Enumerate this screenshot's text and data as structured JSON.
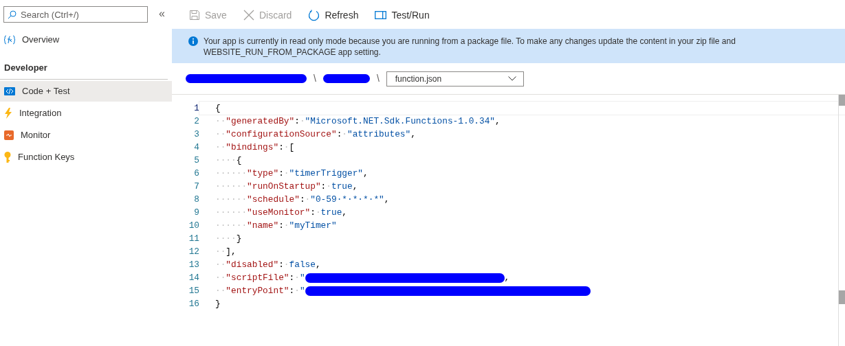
{
  "sidebar": {
    "search": {
      "placeholder": "Search (Ctrl+/)"
    },
    "collapse": "«",
    "items": [
      {
        "label": "Overview",
        "selected": false
      },
      {
        "label": "Developer",
        "kind": "heading"
      },
      {
        "label": "Code + Test",
        "selected": true
      },
      {
        "label": "Integration",
        "selected": false
      },
      {
        "label": "Monitor",
        "selected": false
      },
      {
        "label": "Function Keys",
        "selected": false
      }
    ]
  },
  "toolbar": [
    {
      "label": "Save",
      "disabled": true
    },
    {
      "label": "Discard",
      "disabled": true
    },
    {
      "label": "Refresh",
      "disabled": false
    },
    {
      "label": "Test/Run",
      "disabled": false
    }
  ],
  "banner": {
    "text": "Your app is currently in read only mode because you are running from a package file. To make any changes update the content in your zip file and WEBSITE_RUN_FROM_PACKAGE app setting."
  },
  "breadcrumb": [
    {
      "kind": "redacted"
    },
    {
      "kind": "separator",
      "text": "\\"
    },
    {
      "kind": "redacted"
    },
    {
      "kind": "separator",
      "text": "\\"
    },
    {
      "kind": "dropdown",
      "text": "function.json"
    }
  ],
  "editor": {
    "lines": [
      {
        "number": "1",
        "tokens": [
          {
            "kind": "punct",
            "text": "{"
          }
        ]
      },
      {
        "number": "2",
        "tokens": [
          {
            "kind": "space",
            "text": "··"
          },
          {
            "kind": "key",
            "text": "\"generatedBy\""
          },
          {
            "kind": "punct",
            "text": ":"
          },
          {
            "kind": "space",
            "text": "·"
          },
          {
            "kind": "string",
            "text": "\"Microsoft.NET.Sdk.Functions-1.0.34\""
          },
          {
            "kind": "punct",
            "text": ","
          }
        ]
      },
      {
        "number": "3",
        "tokens": [
          {
            "kind": "space",
            "text": "··"
          },
          {
            "kind": "key",
            "text": "\"configurationSource\""
          },
          {
            "kind": "punct",
            "text": ":"
          },
          {
            "kind": "space",
            "text": "·"
          },
          {
            "kind": "string",
            "text": "\"attributes\""
          },
          {
            "kind": "punct",
            "text": ","
          }
        ]
      },
      {
        "number": "4",
        "tokens": [
          {
            "kind": "space",
            "text": "··"
          },
          {
            "kind": "key",
            "text": "\"bindings\""
          },
          {
            "kind": "punct",
            "text": ":"
          },
          {
            "kind": "space",
            "text": "·"
          },
          {
            "kind": "punct",
            "text": "["
          }
        ]
      },
      {
        "number": "5",
        "tokens": [
          {
            "kind": "space",
            "text": "····"
          },
          {
            "kind": "punct",
            "text": "{"
          }
        ]
      },
      {
        "number": "6",
        "tokens": [
          {
            "kind": "space",
            "text": "······"
          },
          {
            "kind": "key",
            "text": "\"type\""
          },
          {
            "kind": "punct",
            "text": ":"
          },
          {
            "kind": "space",
            "text": "·"
          },
          {
            "kind": "string",
            "text": "\"timerTrigger\""
          },
          {
            "kind": "punct",
            "text": ","
          }
        ]
      },
      {
        "number": "7",
        "tokens": [
          {
            "kind": "space",
            "text": "······"
          },
          {
            "kind": "key",
            "text": "\"runOnStartup\""
          },
          {
            "kind": "punct",
            "text": ":"
          },
          {
            "kind": "space",
            "text": "·"
          },
          {
            "kind": "literal",
            "text": "true"
          },
          {
            "kind": "punct",
            "text": ","
          }
        ]
      },
      {
        "number": "8",
        "tokens": [
          {
            "kind": "space",
            "text": "······"
          },
          {
            "kind": "key",
            "text": "\"schedule\""
          },
          {
            "kind": "punct",
            "text": ":"
          },
          {
            "kind": "space",
            "text": "·"
          },
          {
            "kind": "string",
            "text": "\"0-59·*·*·*·*\""
          },
          {
            "kind": "punct",
            "text": ","
          }
        ]
      },
      {
        "number": "9",
        "tokens": [
          {
            "kind": "space",
            "text": "······"
          },
          {
            "kind": "key",
            "text": "\"useMonitor\""
          },
          {
            "kind": "punct",
            "text": ":"
          },
          {
            "kind": "space",
            "text": "·"
          },
          {
            "kind": "literal",
            "text": "true"
          },
          {
            "kind": "punct",
            "text": ","
          }
        ]
      },
      {
        "number": "10",
        "tokens": [
          {
            "kind": "space",
            "text": "······"
          },
          {
            "kind": "key",
            "text": "\"name\""
          },
          {
            "kind": "punct",
            "text": ":"
          },
          {
            "kind": "space",
            "text": "·"
          },
          {
            "kind": "string",
            "text": "\"myTimer\""
          }
        ]
      },
      {
        "number": "11",
        "tokens": [
          {
            "kind": "space",
            "text": "····"
          },
          {
            "kind": "punct",
            "text": "}"
          }
        ]
      },
      {
        "number": "12",
        "tokens": [
          {
            "kind": "space",
            "text": "··"
          },
          {
            "kind": "punct",
            "text": "],"
          }
        ]
      },
      {
        "number": "13",
        "tokens": [
          {
            "kind": "space",
            "text": "··"
          },
          {
            "kind": "key",
            "text": "\"disabled\""
          },
          {
            "kind": "punct",
            "text": ":"
          },
          {
            "kind": "space",
            "text": "·"
          },
          {
            "kind": "literal",
            "text": "false"
          },
          {
            "kind": "punct",
            "text": ","
          }
        ]
      },
      {
        "number": "14",
        "tokens": [
          {
            "kind": "space",
            "text": "··"
          },
          {
            "kind": "key",
            "text": "\"scriptFile\""
          },
          {
            "kind": "punct",
            "text": ":"
          },
          {
            "kind": "space",
            "text": "·"
          },
          {
            "kind": "string",
            "text": "\""
          },
          {
            "kind": "redacted"
          },
          {
            "kind": "punct",
            "text": ","
          }
        ]
      },
      {
        "number": "15",
        "tokens": [
          {
            "kind": "space",
            "text": "··"
          },
          {
            "kind": "key",
            "text": "\"entryPoint\""
          },
          {
            "kind": "punct",
            "text": ":"
          },
          {
            "kind": "space",
            "text": "·"
          },
          {
            "kind": "string",
            "text": "\""
          },
          {
            "kind": "redacted"
          }
        ]
      },
      {
        "number": "16",
        "tokens": [
          {
            "kind": "punct",
            "text": "}"
          }
        ]
      }
    ]
  }
}
